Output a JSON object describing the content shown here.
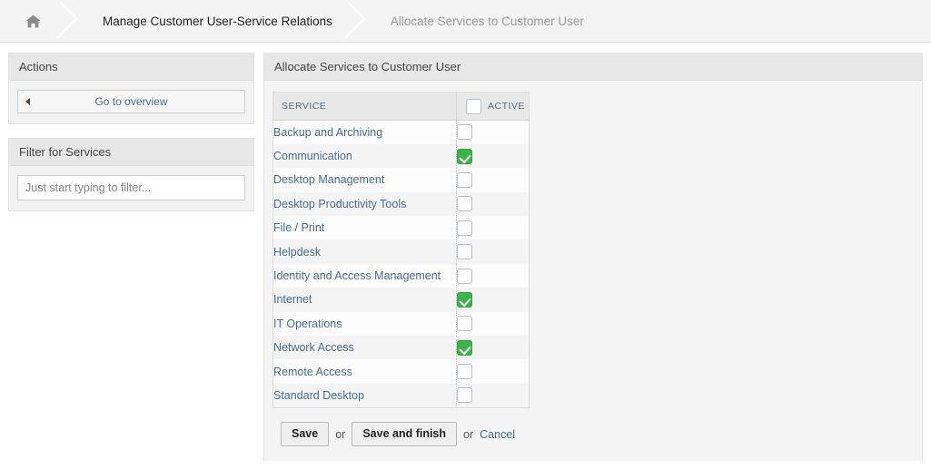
{
  "breadcrumb": {
    "home_icon": "home-icon",
    "items": [
      {
        "label": "Manage Customer User-Service Relations",
        "current": false
      },
      {
        "label": "Allocate Services to Customer User",
        "current": true
      }
    ]
  },
  "sidebar": {
    "actions": {
      "title": "Actions",
      "go_to_overview_label": "Go to overview",
      "back_icon": "triangle-left-icon"
    },
    "filter": {
      "title": "Filter for Services",
      "input_value": "",
      "input_placeholder": "Just start typing to filter..."
    }
  },
  "main": {
    "header_title": "Allocate Services to Customer User",
    "table": {
      "columns": [
        "SERVICE",
        "ACTIVE"
      ],
      "master_checkbox_checked": false,
      "rows": [
        {
          "service": "Backup and Archiving",
          "active": false
        },
        {
          "service": "Communication",
          "active": true
        },
        {
          "service": "Desktop Management",
          "active": false
        },
        {
          "service": "Desktop Productivity Tools",
          "active": false
        },
        {
          "service": "File / Print",
          "active": false
        },
        {
          "service": "Helpdesk",
          "active": false
        },
        {
          "service": "Identity and Access Management",
          "active": false
        },
        {
          "service": "Internet",
          "active": true
        },
        {
          "service": "IT Operations",
          "active": false
        },
        {
          "service": "Network Access",
          "active": true
        },
        {
          "service": "Remote Access",
          "active": false
        },
        {
          "service": "Standard Desktop",
          "active": false
        }
      ]
    },
    "footer": {
      "save_label": "Save",
      "or_label_1": "or",
      "save_and_finish_label": "Save and finish",
      "or_label_2": "or",
      "cancel_label": "Cancel"
    }
  },
  "colors": {
    "accent_green": "#3bb54a",
    "link_blue": "#4a6d8c",
    "panel_header": "#e7e7e7",
    "page_bg": "#ffffff"
  }
}
